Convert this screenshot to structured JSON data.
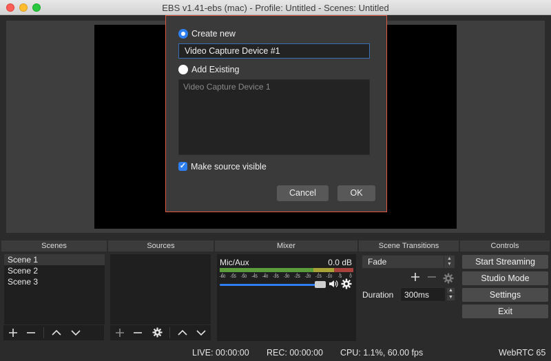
{
  "window": {
    "title": "EBS v1.41-ebs (mac) - Profile: Untitled - Scenes: Untitled"
  },
  "dialog": {
    "create_new_label": "Create new",
    "name_value": "Video Capture Device #1",
    "add_existing_label": "Add Existing",
    "existing_items": [
      "Video Capture Device 1"
    ],
    "make_visible_label": "Make source visible",
    "cancel_label": "Cancel",
    "ok_label": "OK",
    "create_new_selected": true,
    "make_visible_checked": true
  },
  "scenes": {
    "title": "Scenes",
    "items": [
      "Scene 1",
      "Scene 2",
      "Scene 3"
    ],
    "selected_index": 0
  },
  "sources": {
    "title": "Sources"
  },
  "mixer": {
    "title": "Mixer",
    "channel_name": "Mic/Aux",
    "level_db": "0.0 dB",
    "scale_labels": [
      "-60",
      "-55",
      "-50",
      "-45",
      "-40",
      "-35",
      "-30",
      "-25",
      "-20",
      "-15",
      "-10",
      "-5",
      "0"
    ],
    "volume_fraction": 1.0
  },
  "transitions": {
    "title": "Scene Transitions",
    "selected": "Fade",
    "duration_label": "Duration",
    "duration_value": "300ms"
  },
  "controls": {
    "title": "Controls",
    "start_streaming": "Start Streaming",
    "studio_mode": "Studio Mode",
    "settings": "Settings",
    "exit": "Exit"
  },
  "status": {
    "live": "LIVE: 00:00:00",
    "rec": "REC: 00:00:00",
    "cpu": "CPU: 1.1%, 60.00 fps",
    "webrtc": "WebRTC 65"
  },
  "colors": {
    "accent": "#2d7ff0",
    "dialog_border": "#e0593e",
    "meter_green": "#5b9d3a",
    "meter_yellow": "#a8a336",
    "meter_red": "#a6423b"
  },
  "icons": {
    "add": "plus-icon",
    "remove": "minus-icon",
    "up": "chevron-up-icon",
    "down": "chevron-down-icon",
    "gear": "gear-icon",
    "speaker": "speaker-icon"
  }
}
